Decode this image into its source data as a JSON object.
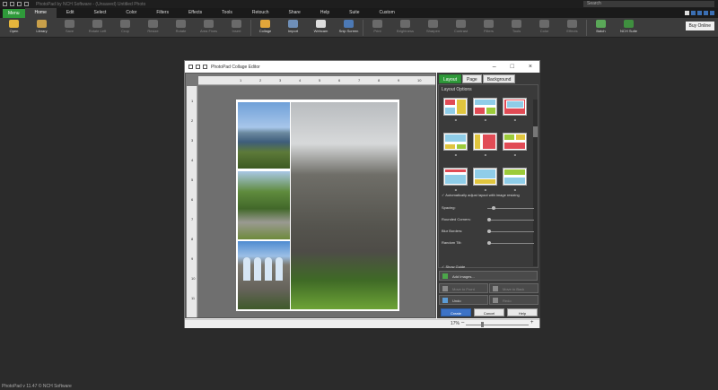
{
  "window": {
    "title": "PhotoPad by NCH Software - (Unsaved) Untitled Photo",
    "search_placeholder": "Search"
  },
  "menu": {
    "menu_button": "Menu",
    "tabs": [
      "Home",
      "Edit",
      "Select",
      "Color",
      "Filters",
      "Effects",
      "Tools",
      "Retouch",
      "Share",
      "Help",
      "Suite",
      "Custom"
    ],
    "active_tab": "Home"
  },
  "ribbon": {
    "buttons": [
      {
        "label": "Open",
        "enabled": true,
        "color": "#e5b53c"
      },
      {
        "label": "Library",
        "enabled": true,
        "color": "#c9a04a"
      },
      {
        "label": "Save",
        "enabled": false
      },
      {
        "label": "Rotate Left",
        "enabled": false
      },
      {
        "label": "Crop",
        "enabled": false
      },
      {
        "label": "Resize",
        "enabled": false
      },
      {
        "label": "Rotate",
        "enabled": false
      },
      {
        "label": "Area Fixes",
        "enabled": false
      },
      {
        "label": "Insert",
        "enabled": false
      },
      {
        "label": "Collage",
        "enabled": true,
        "color": "#e2a63a"
      },
      {
        "label": "Import",
        "enabled": true,
        "color": "#6f8fb8"
      },
      {
        "label": "Webcam",
        "enabled": true,
        "color": "#dddddd"
      },
      {
        "label": "Snip Screen",
        "enabled": true,
        "color": "#4c79b5"
      },
      {
        "label": "Print",
        "enabled": false
      },
      {
        "label": "Brightness",
        "enabled": false
      },
      {
        "label": "Sharpen",
        "enabled": false
      },
      {
        "label": "Contrast",
        "enabled": false
      },
      {
        "label": "Filters",
        "enabled": false
      },
      {
        "label": "Tools",
        "enabled": false
      },
      {
        "label": "Color",
        "enabled": false
      },
      {
        "label": "Effects",
        "enabled": false
      },
      {
        "label": "Batch",
        "enabled": true,
        "color": "#5aa858"
      },
      {
        "label": "NCH Suite",
        "enabled": true,
        "color": "#3f8f3f"
      }
    ],
    "buy_online": "Buy Online"
  },
  "dialog": {
    "title": "PhotoPad Collage Editor",
    "ruler_top": [
      "1",
      "2",
      "3",
      "4",
      "5",
      "6",
      "7",
      "8",
      "9",
      "10"
    ],
    "ruler_left": [
      "1",
      "2",
      "3",
      "4",
      "5",
      "6",
      "7",
      "8",
      "9",
      "10",
      "11"
    ],
    "tabs": [
      "Layout",
      "Page",
      "Background"
    ],
    "active_tab": "Layout",
    "layout_options_title": "Layout Options",
    "auto_adjust": "Automatically adjust layout with image resizing",
    "sliders": [
      {
        "label": "Spacing:",
        "value": 0.1
      },
      {
        "label": "Rounded Corners:",
        "value": 0.0
      },
      {
        "label": "Blur Borders:",
        "value": 0.0
      },
      {
        "label": "Random Tilt:",
        "value": 0.0
      }
    ],
    "show_guide": "Show Guide",
    "add_images": "Add Images...",
    "move_to_front": "Move to Front",
    "move_to_back": "Move to Back",
    "undo": "Undo",
    "redo": "Redo",
    "create": "Create",
    "cancel": "Cancel",
    "help": "Help",
    "zoom": "17%",
    "zoom_level": 0.25
  },
  "status": {
    "text": "PhotoPad v 11.47 © NCH Software"
  }
}
